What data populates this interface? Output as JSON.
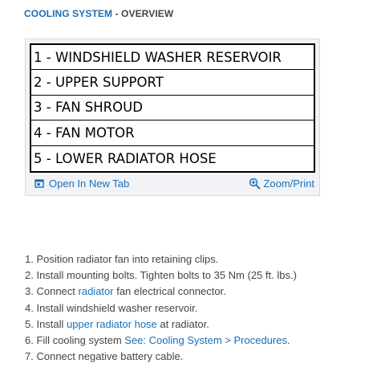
{
  "heading": {
    "link": "COOLING SYSTEM",
    "rest": " - OVERVIEW"
  },
  "figure": {
    "legend": [
      "1 - WINDSHIELD WASHER RESERVOIR",
      "2 - UPPER SUPPORT",
      "3 - FAN SHROUD",
      "4 - FAN MOTOR",
      "5 - LOWER RADIATOR HOSE"
    ],
    "open_new_tab": "Open In New Tab",
    "zoom_print": "Zoom/Print",
    "open_icon": "new-window-icon",
    "zoom_icon": "magnifier-plus-icon"
  },
  "steps": [
    {
      "num": "1. ",
      "parts": [
        {
          "text": "Position radiator fan into retaining clips."
        }
      ]
    },
    {
      "num": "2. ",
      "parts": [
        {
          "text": "Install mounting bolts. Tighten bolts to 35 Nm (25 ft. lbs.)"
        }
      ]
    },
    {
      "num": "3. ",
      "parts": [
        {
          "text": "Connect "
        },
        {
          "text": "radiator",
          "link": true
        },
        {
          "text": " fan electrical connector."
        }
      ]
    },
    {
      "num": "4. ",
      "parts": [
        {
          "text": "Install windshield washer reservoir."
        }
      ]
    },
    {
      "num": "5. ",
      "parts": [
        {
          "text": "Install "
        },
        {
          "text": "upper radiator hose",
          "link": true
        },
        {
          "text": " at radiator."
        }
      ]
    },
    {
      "num": "6. ",
      "parts": [
        {
          "text": "Fill cooling system "
        },
        {
          "text": "See: Cooling System > Procedures",
          "link": true
        },
        {
          "text": "."
        }
      ]
    },
    {
      "num": "7. ",
      "parts": [
        {
          "text": "Connect negative battery cable."
        }
      ]
    }
  ],
  "colors": {
    "link": "#1a6fb8",
    "text": "#444444",
    "figure_bg": "#f1f3f6"
  }
}
